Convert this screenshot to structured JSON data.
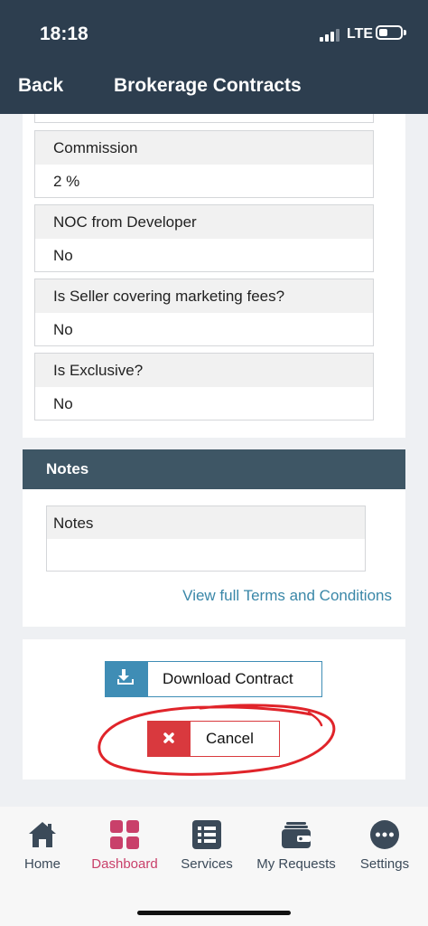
{
  "status_bar": {
    "time": "18:18",
    "network": "LTE"
  },
  "nav": {
    "back_label": "Back",
    "title": "Brokerage Contracts"
  },
  "details": {
    "fields": [
      {
        "label": "Commission",
        "value": "2 %"
      },
      {
        "label": "NOC from Developer",
        "value": "No"
      },
      {
        "label": "Is Seller covering marketing fees?",
        "value": "No"
      },
      {
        "label": "Is Exclusive?",
        "value": "No"
      }
    ]
  },
  "notes": {
    "header": "Notes",
    "field_label": "Notes",
    "field_value": "",
    "terms_link": "View full Terms and Conditions"
  },
  "actions": {
    "download_label": "Download Contract",
    "cancel_label": "Cancel"
  },
  "tabs": [
    {
      "label": "Home",
      "icon": "house-icon",
      "active": false
    },
    {
      "label": "Dashboard",
      "icon": "grid-icon",
      "active": true
    },
    {
      "label": "Services",
      "icon": "list-icon",
      "active": false
    },
    {
      "label": "My Requests",
      "icon": "wallet-icon",
      "active": false
    },
    {
      "label": "Settings",
      "icon": "more-dots-icon",
      "active": false
    }
  ],
  "colors": {
    "header_bg": "#2d3e4f",
    "section_header_bg": "#3e5665",
    "download_accent": "#3f8db5",
    "cancel_accent": "#d9393e",
    "link": "#3a87a8",
    "tab_active": "#c9406a",
    "tab_inactive": "#3b4a59",
    "annotation": "#e0242a"
  }
}
